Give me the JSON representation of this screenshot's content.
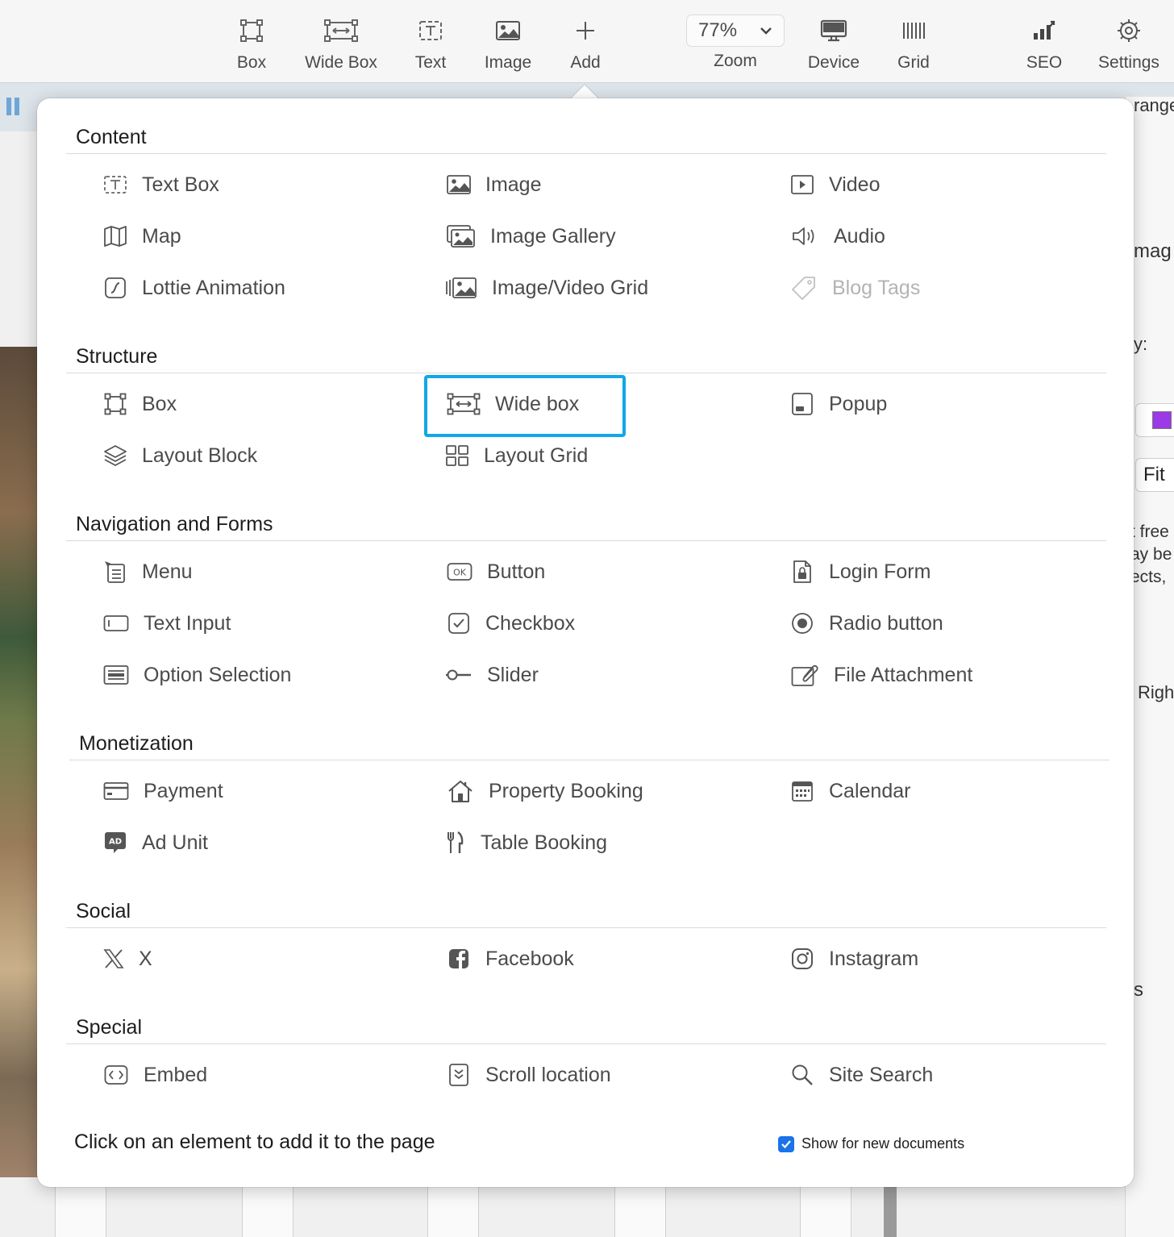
{
  "toolbar": {
    "items": [
      {
        "label": "Box",
        "icon": "box-icon"
      },
      {
        "label": "Wide Box",
        "icon": "wide-box-icon"
      },
      {
        "label": "Text",
        "icon": "text-icon"
      },
      {
        "label": "Image",
        "icon": "image-icon"
      },
      {
        "label": "Add",
        "icon": "plus-icon"
      }
    ],
    "zoom": {
      "value": "77%",
      "label": "Zoom"
    },
    "right_items": [
      {
        "label": "Device",
        "icon": "monitor-icon"
      },
      {
        "label": "Grid",
        "icon": "grid-icon"
      },
      {
        "label": "SEO",
        "icon": "seo-icon"
      },
      {
        "label": "Settings",
        "icon": "gear-icon"
      }
    ]
  },
  "background_panel": {
    "texts": [
      "range",
      "mag",
      "y:",
      "Fit",
      "t free",
      "ay be",
      "ects,",
      "Righ",
      "s"
    ],
    "swatch_color": "#9b3ae6"
  },
  "add_menu": {
    "sections": {
      "content": {
        "title": "Content",
        "items": [
          "Text Box",
          "Image",
          "Video",
          "Map",
          "Image Gallery",
          "Audio",
          "Lottie Animation",
          "Image/Video Grid",
          "Blog Tags"
        ]
      },
      "structure": {
        "title": "Structure",
        "items": [
          "Box",
          "Wide box",
          "Popup",
          "Layout Block",
          "Layout Grid"
        ]
      },
      "navigation": {
        "title": "Navigation and Forms",
        "items": [
          "Menu",
          "Button",
          "Login Form",
          "Text Input",
          "Checkbox",
          "Radio button",
          "Option Selection",
          "Slider",
          "File Attachment"
        ]
      },
      "monetization": {
        "title": "Monetization",
        "items": [
          "Payment",
          "Property Booking",
          "Calendar",
          "Ad Unit",
          "Table Booking"
        ]
      },
      "social": {
        "title": "Social",
        "items": [
          "X",
          "Facebook",
          "Instagram"
        ]
      },
      "special": {
        "title": "Special",
        "items": [
          "Embed",
          "Scroll location",
          "Site Search"
        ]
      }
    },
    "selected_item": "Wide box",
    "disabled_items": [
      "Blog Tags"
    ],
    "footer": {
      "hint": "Click on an element to add it to the page",
      "show_for_new_documents": {
        "label": "Show for new documents",
        "checked": true
      }
    },
    "accent_color": "#10a8e6"
  }
}
